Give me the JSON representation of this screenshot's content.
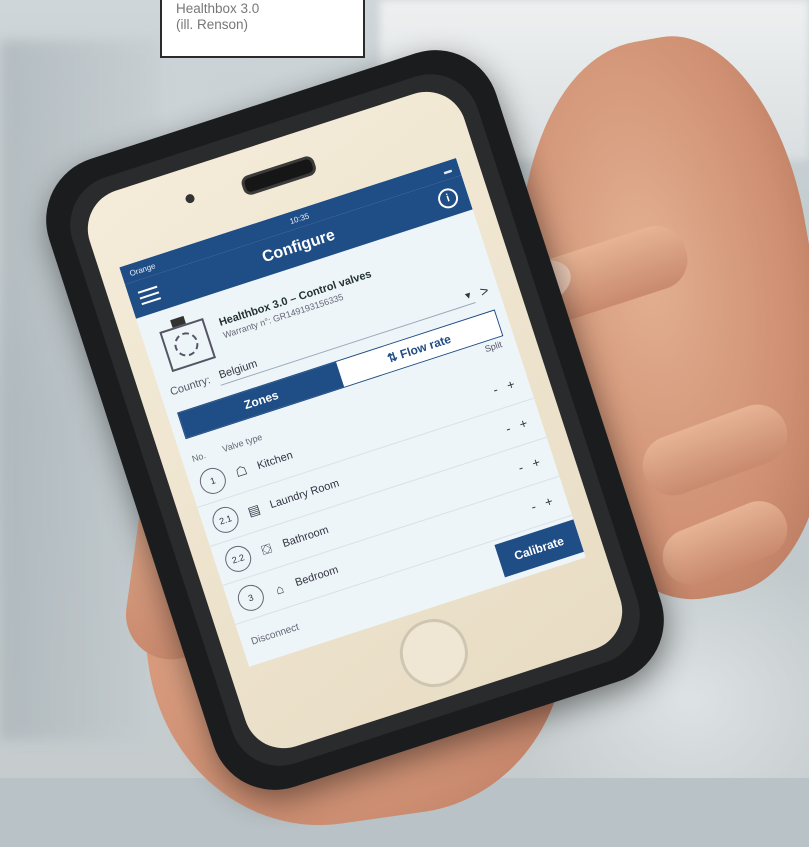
{
  "caption": {
    "line1": "Healthbox 3.0",
    "line2": "(ill. Renson)"
  },
  "app": {
    "status": {
      "carrier": "Orange",
      "time": "10:35"
    },
    "nav": {
      "title": "Configure",
      "menu_icon": "hamburger-icon",
      "info_icon": "info-icon",
      "info_glyph": "i"
    },
    "device": {
      "name": "Healthbox 3.0 – Control valves",
      "serial": "Warranty n°: GR149193156335"
    },
    "country": {
      "label": "Country:",
      "value": "Belgium",
      "dropdown_glyph": "▾",
      "next_glyph": ">"
    },
    "tabs": [
      {
        "label": "Zones",
        "active": true
      },
      {
        "label": "Flow rate",
        "icon": "flow-icon",
        "active": false
      }
    ],
    "split_label": "Split",
    "columns": {
      "no": "No.",
      "valve_type": "Valve type"
    },
    "zones": [
      {
        "no": "1",
        "icon": "☖",
        "name": "Kitchen"
      },
      {
        "no": "2.1",
        "icon": "▤",
        "name": "Laundry Room"
      },
      {
        "no": "2.2",
        "icon": "⛋",
        "name": "Bathroom"
      },
      {
        "no": "3",
        "icon": "⌂",
        "name": "Bedroom"
      }
    ],
    "controls": {
      "minus": "-",
      "plus": "+"
    },
    "footer": {
      "disconnect": "Disconnect",
      "calibrate": "Calibrate"
    }
  }
}
